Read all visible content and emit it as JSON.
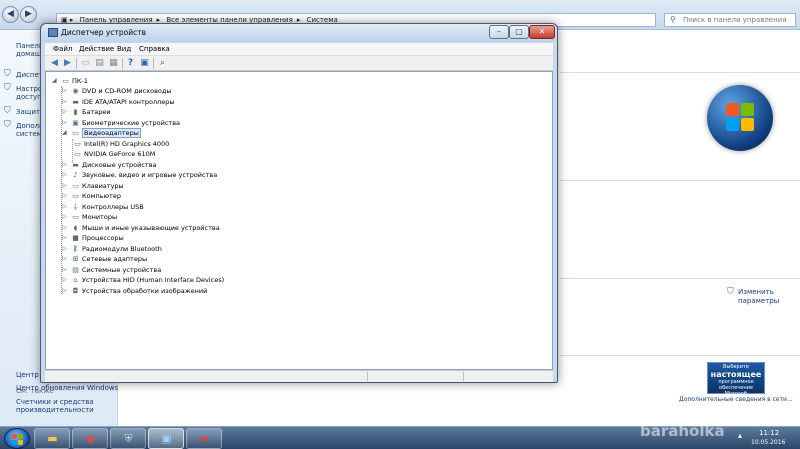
{
  "control_panel": {
    "breadcrumb": [
      "Панель управления",
      "Все элементы панели управления",
      "Система"
    ],
    "search_placeholder": "Поиск в панели управления",
    "side_links": [
      {
        "label1": "Панель",
        "label2": "домашн"
      },
      {
        "label1": "Диспет"
      },
      {
        "label1": "Настро",
        "label2": "доступа"
      },
      {
        "label1": "Защита"
      },
      {
        "label1": "Дополн",
        "label2": "система"
      }
    ],
    "see_also": "См. также",
    "side_bottom": [
      "Центр",
      "Центр обновления Windows",
      "Счетчики и средства",
      "производительности"
    ],
    "change_link_1": "Изменить",
    "change_link_2": "параметры",
    "genuine_top": "Выберите",
    "genuine_big": "настоящее",
    "genuine_sub": "программное обеспечение",
    "genuine_brand": "Microsoft",
    "genuine_link": "Дополнительные сведения в сети..."
  },
  "device_manager": {
    "title": "Диспетчер устройств",
    "menu": [
      "Файл",
      "Действие",
      "Вид",
      "Справка"
    ],
    "tree": {
      "root": "ПК-1",
      "categories": [
        "DVD и CD-ROM дисководы",
        "IDE ATA/ATAPI контроллеры",
        "Батареи",
        "Биометрические устройства",
        "Видеоадаптеры",
        "Дисковые устройства",
        "Звуковые, видео и игровые устройства",
        "Клавиатуры",
        "Компьютер",
        "Контроллеры USB",
        "Мониторы",
        "Мыши и иные указывающие устройства",
        "Процессоры",
        "Радиомодули Bluetooth",
        "Сетевые адаптеры",
        "Системные устройства",
        "Устройства HID (Human Interface Devices)",
        "Устройства обработки изображений"
      ],
      "video_children": [
        "Intel(R) HD Graphics 4000",
        "NVIDIA GeForce 610M"
      ]
    }
  },
  "taskbar": {
    "time": "11:12",
    "date": "10.05.2016"
  },
  "watermark": "baraholka"
}
